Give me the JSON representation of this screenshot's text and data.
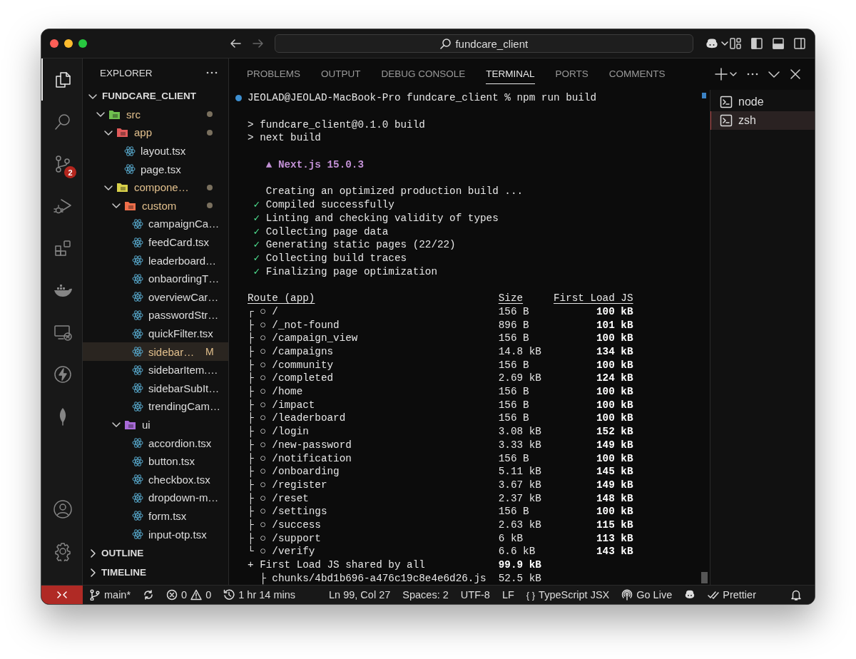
{
  "title_bar": {
    "search": "fundcare_client"
  },
  "activity_bar": {
    "items": [
      {
        "kind": "explorer",
        "selected": true
      },
      {
        "kind": "search",
        "selected": false
      },
      {
        "kind": "source-control",
        "selected": false,
        "badge": "2"
      },
      {
        "kind": "run-debug",
        "selected": false
      },
      {
        "kind": "extensions",
        "selected": false
      },
      {
        "kind": "docker",
        "selected": false
      },
      {
        "kind": "remote",
        "selected": false
      },
      {
        "kind": "lightning",
        "selected": false
      },
      {
        "kind": "leaf",
        "selected": false
      }
    ],
    "bottom": [
      {
        "kind": "account"
      },
      {
        "kind": "settings"
      }
    ]
  },
  "sidebar": {
    "title": "EXPLORER",
    "tree": [
      {
        "label": "FUNDCARE_CLIENT",
        "kind": "root",
        "expanded": true,
        "selected": false,
        "children": [
          {
            "label": "src",
            "kind": "folder",
            "color": "#6fbf4f",
            "expanded": true,
            "modified": true,
            "selected": false,
            "children": [
              {
                "label": "app",
                "kind": "folder",
                "color": "#e05a5a",
                "expanded": true,
                "modified": true,
                "selected": false,
                "children": [
                  {
                    "label": "layout.tsx",
                    "kind": "file",
                    "selected": false
                  },
                  {
                    "label": "page.tsx",
                    "kind": "file",
                    "selected": false
                  }
                ]
              },
              {
                "label": "compone…",
                "kind": "folder",
                "color": "#d8d04a",
                "expanded": true,
                "modified": true,
                "selected": false,
                "children": [
                  {
                    "label": "custom",
                    "kind": "folder",
                    "color": "#ee6e4a",
                    "expanded": true,
                    "modified": true,
                    "selected": false,
                    "children": [
                      {
                        "label": "campaignCa…",
                        "kind": "file",
                        "selected": false
                      },
                      {
                        "label": "feedCard.tsx",
                        "kind": "file",
                        "selected": false
                      },
                      {
                        "label": "leaderboard…",
                        "kind": "file",
                        "selected": false
                      },
                      {
                        "label": "onbaordingT…",
                        "kind": "file",
                        "selected": false
                      },
                      {
                        "label": "overviewCar…",
                        "kind": "file",
                        "selected": false
                      },
                      {
                        "label": "passwordStr…",
                        "kind": "file",
                        "selected": false
                      },
                      {
                        "label": "quickFilter.tsx",
                        "kind": "file",
                        "selected": false
                      },
                      {
                        "label": "sidebar…",
                        "kind": "file",
                        "selected": true,
                        "status": "M"
                      },
                      {
                        "label": "sidebarItem.…",
                        "kind": "file",
                        "selected": false
                      },
                      {
                        "label": "sidebarSubIt…",
                        "kind": "file",
                        "selected": false
                      },
                      {
                        "label": "trendingCam…",
                        "kind": "file",
                        "selected": false
                      }
                    ]
                  },
                  {
                    "label": "ui",
                    "kind": "folder",
                    "color": "#a86ad8",
                    "expanded": true,
                    "modified": false,
                    "selected": false,
                    "children": [
                      {
                        "label": "accordion.tsx",
                        "kind": "file",
                        "selected": false
                      },
                      {
                        "label": "button.tsx",
                        "kind": "file",
                        "selected": false
                      },
                      {
                        "label": "checkbox.tsx",
                        "kind": "file",
                        "selected": false
                      },
                      {
                        "label": "dropdown-m…",
                        "kind": "file",
                        "selected": false
                      },
                      {
                        "label": "form.tsx",
                        "kind": "file",
                        "selected": false
                      },
                      {
                        "label": "input-otp.tsx",
                        "kind": "file",
                        "selected": false
                      }
                    ]
                  }
                ]
              }
            ]
          }
        ]
      }
    ],
    "sections": [
      {
        "label": "OUTLINE",
        "expanded": false
      },
      {
        "label": "TIMELINE",
        "expanded": false
      }
    ]
  },
  "panel": {
    "tabs": [
      {
        "label": "PROBLEMS",
        "selected": false
      },
      {
        "label": "OUTPUT",
        "selected": false
      },
      {
        "label": "DEBUG CONSOLE",
        "selected": false
      },
      {
        "label": "TERMINAL",
        "selected": true
      },
      {
        "label": "PORTS",
        "selected": false
      },
      {
        "label": "COMMENTS",
        "selected": false
      }
    ],
    "terminal": {
      "lines": [
        {
          "kind": "prompt",
          "text": "JEOLAD@JEOLAD-MacBook-Pro fundcare_client % npm run build"
        },
        {
          "kind": "blank"
        },
        {
          "kind": "plain",
          "text": "> fundcare_client@0.1.0 build"
        },
        {
          "kind": "plain",
          "text": "> next build"
        },
        {
          "kind": "blank"
        },
        {
          "kind": "banner",
          "text": "▲ Next.js 15.0.3"
        },
        {
          "kind": "blank"
        },
        {
          "kind": "info",
          "text": "Creating an optimized production build ..."
        },
        {
          "kind": "check",
          "mark": "✓",
          "text": "Compiled successfully"
        },
        {
          "kind": "check",
          "mark": "✓",
          "text": "Linting and checking validity of types"
        },
        {
          "kind": "check",
          "mark": "✓",
          "text": "Collecting page data"
        },
        {
          "kind": "check",
          "mark": "✓",
          "text": "Generating static pages (22/22)"
        },
        {
          "kind": "check",
          "mark": "✓",
          "text": "Collecting build traces"
        },
        {
          "kind": "check",
          "mark": "✓",
          "text": "Finalizing page optimization"
        },
        {
          "kind": "blank"
        }
      ],
      "route_table": {
        "columns": [
          "Route (app)",
          "Size",
          "First Load JS"
        ],
        "rows": [
          {
            "kind": "route",
            "name": "┌ ○ /",
            "size": "156 B",
            "first_load": "100 kB"
          },
          {
            "kind": "route",
            "name": "├ ○ /_not-found",
            "size": "896 B",
            "first_load": "101 kB"
          },
          {
            "kind": "route",
            "name": "├ ○ /campaign_view",
            "size": "156 B",
            "first_load": "100 kB"
          },
          {
            "kind": "route",
            "name": "├ ○ /campaigns",
            "size": "14.8 kB",
            "first_load": "134 kB"
          },
          {
            "kind": "route",
            "name": "├ ○ /community",
            "size": "156 B",
            "first_load": "100 kB"
          },
          {
            "kind": "route",
            "name": "├ ○ /completed",
            "size": "2.69 kB",
            "first_load": "124 kB"
          },
          {
            "kind": "route",
            "name": "├ ○ /home",
            "size": "156 B",
            "first_load": "100 kB"
          },
          {
            "kind": "route",
            "name": "├ ○ /impact",
            "size": "156 B",
            "first_load": "100 kB"
          },
          {
            "kind": "route",
            "name": "├ ○ /leaderboard",
            "size": "156 B",
            "first_load": "100 kB"
          },
          {
            "kind": "route",
            "name": "├ ○ /login",
            "size": "3.08 kB",
            "first_load": "152 kB"
          },
          {
            "kind": "route",
            "name": "├ ○ /new-password",
            "size": "3.33 kB",
            "first_load": "149 kB"
          },
          {
            "kind": "route",
            "name": "├ ○ /notification",
            "size": "156 B",
            "first_load": "100 kB"
          },
          {
            "kind": "route",
            "name": "├ ○ /onboarding",
            "size": "5.11 kB",
            "first_load": "145 kB"
          },
          {
            "kind": "route",
            "name": "├ ○ /register",
            "size": "3.67 kB",
            "first_load": "149 kB"
          },
          {
            "kind": "route",
            "name": "├ ○ /reset",
            "size": "2.37 kB",
            "first_load": "148 kB"
          },
          {
            "kind": "route",
            "name": "├ ○ /settings",
            "size": "156 B",
            "first_load": "100 kB"
          },
          {
            "kind": "route",
            "name": "├ ○ /success",
            "size": "2.63 kB",
            "first_load": "115 kB"
          },
          {
            "kind": "route",
            "name": "├ ○ /support",
            "size": "6 kB",
            "first_load": "113 kB"
          },
          {
            "kind": "route",
            "name": "└ ○ /verify",
            "size": "6.6 kB",
            "first_load": "143 kB"
          },
          {
            "kind": "shared",
            "name": "+ First Load JS shared by all",
            "size": "99.9 kB"
          },
          {
            "kind": "chunk",
            "name": "├ chunks/4bd1b696-a476c19c8e4e6d26.js",
            "size": "52.5 kB"
          }
        ]
      }
    },
    "terminals": [
      {
        "label": "node",
        "selected": false
      },
      {
        "label": "zsh",
        "selected": true
      }
    ]
  },
  "status_bar": {
    "items": [
      {
        "kind": "remote"
      },
      {
        "kind": "branch",
        "text": "main*"
      },
      {
        "kind": "sync"
      },
      {
        "kind": "errors",
        "text": "0"
      },
      {
        "kind": "warnings",
        "text": "0"
      },
      {
        "kind": "clock",
        "text": "1 hr 14 mins"
      },
      {
        "kind": "plain",
        "text": "Ln 99, Col 27"
      },
      {
        "kind": "plain",
        "text": "Spaces: 2"
      },
      {
        "kind": "plain",
        "text": "UTF-8"
      },
      {
        "kind": "plain",
        "text": "LF"
      },
      {
        "kind": "language",
        "glyph": "{ }",
        "text": "TypeScript JSX"
      },
      {
        "kind": "broadcast",
        "text": "Go Live"
      },
      {
        "kind": "copilot"
      },
      {
        "kind": "checks",
        "text": "Prettier"
      },
      {
        "kind": "bell"
      }
    ]
  }
}
